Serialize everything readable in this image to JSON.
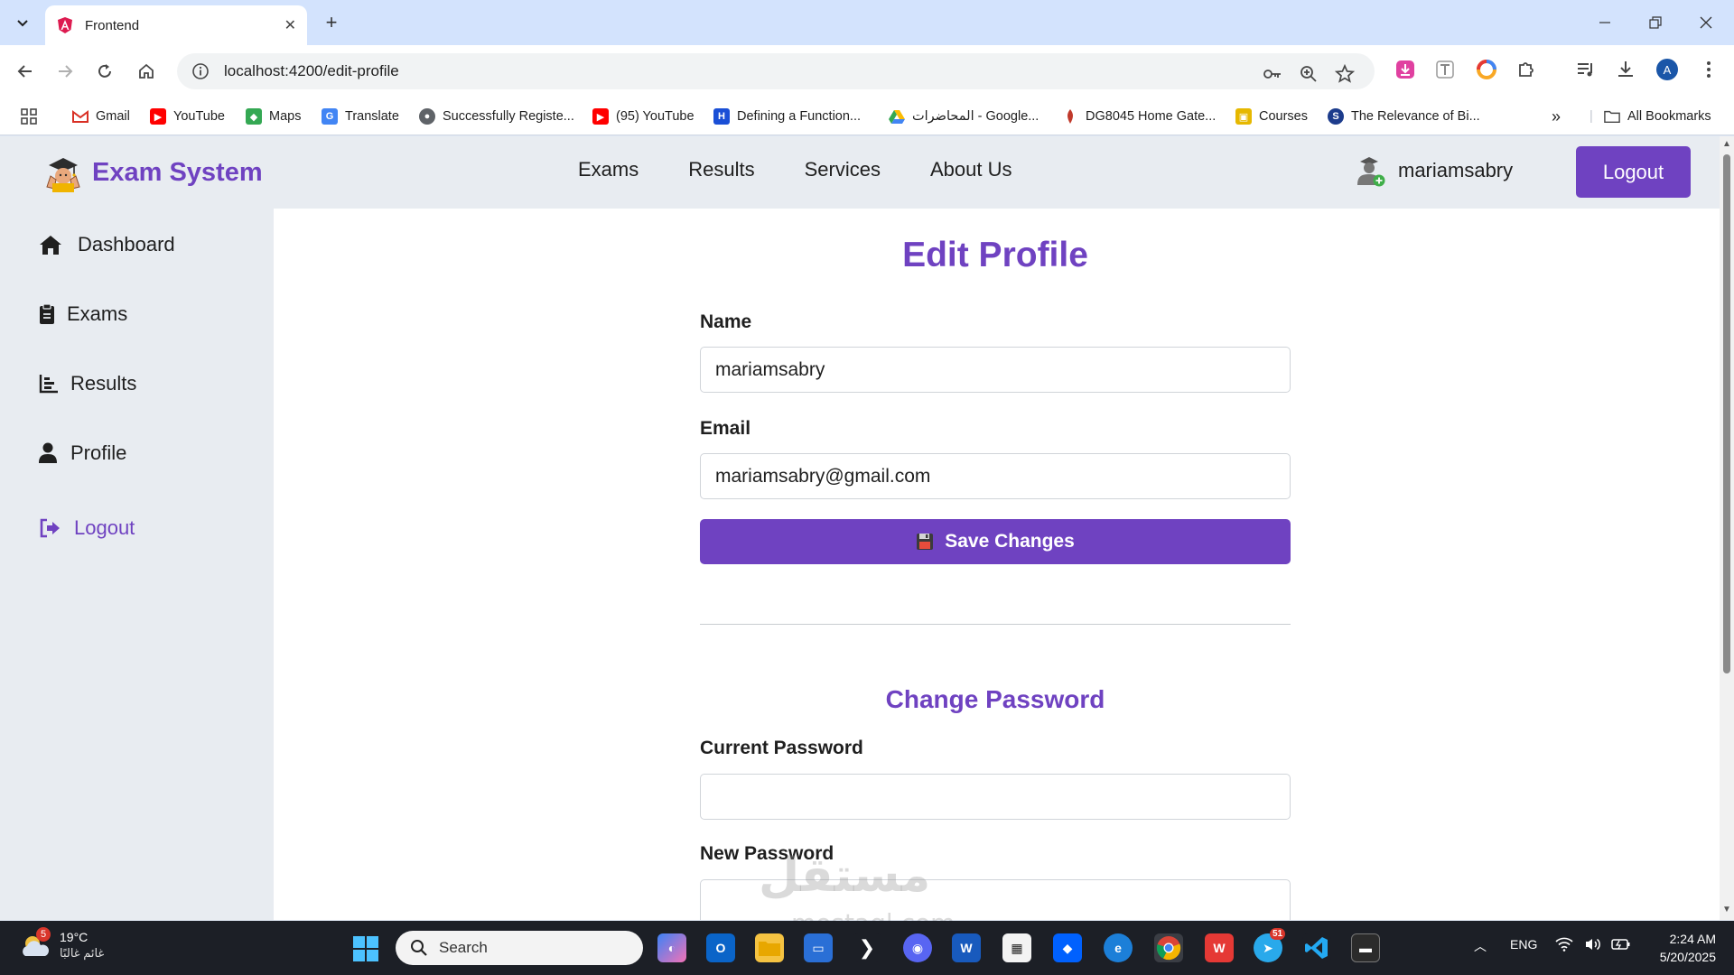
{
  "browser": {
    "tab_title": "Frontend",
    "url": "localhost:4200/edit-profile",
    "profile_initial": "A",
    "bookmarks": [
      {
        "label": "Gmail"
      },
      {
        "label": "YouTube"
      },
      {
        "label": "Maps"
      },
      {
        "label": "Translate"
      },
      {
        "label": "Successfully Registe..."
      },
      {
        "label": "(95) YouTube"
      },
      {
        "label": "Defining a Function..."
      },
      {
        "label": "المحاضرات - Google..."
      },
      {
        "label": "DG8045 Home Gate..."
      },
      {
        "label": "Courses"
      },
      {
        "label": "The Relevance of Bi..."
      }
    ],
    "all_bookmarks": "All Bookmarks"
  },
  "app": {
    "brand": "Exam System",
    "nav": [
      "Exams",
      "Results",
      "Services",
      "About Us"
    ],
    "username": "mariamsabry",
    "logout_label": "Logout"
  },
  "sidebar": {
    "items": [
      {
        "label": "Dashboard"
      },
      {
        "label": "Exams"
      },
      {
        "label": "Results"
      },
      {
        "label": "Profile"
      },
      {
        "label": "Logout"
      }
    ]
  },
  "form": {
    "title": "Edit Profile",
    "name_label": "Name",
    "name_value": "mariamsabry",
    "email_label": "Email",
    "email_value": "mariamsabry@gmail.com",
    "save_label": "Save Changes",
    "change_password_title": "Change Password",
    "current_password_label": "Current Password",
    "new_password_label": "New Password"
  },
  "watermark": {
    "text": "مستقل",
    "sub": "mostaql.com"
  },
  "taskbar": {
    "weather_badge": "5",
    "temperature": "19°C",
    "condition": "غائم غالبًا",
    "search_placeholder": "Search",
    "telegram_badge": "51",
    "language": "ENG",
    "time": "2:24 AM",
    "date": "5/20/2025"
  },
  "colors": {
    "accent": "#6f42c1",
    "page_bg": "#e8ecf1"
  }
}
